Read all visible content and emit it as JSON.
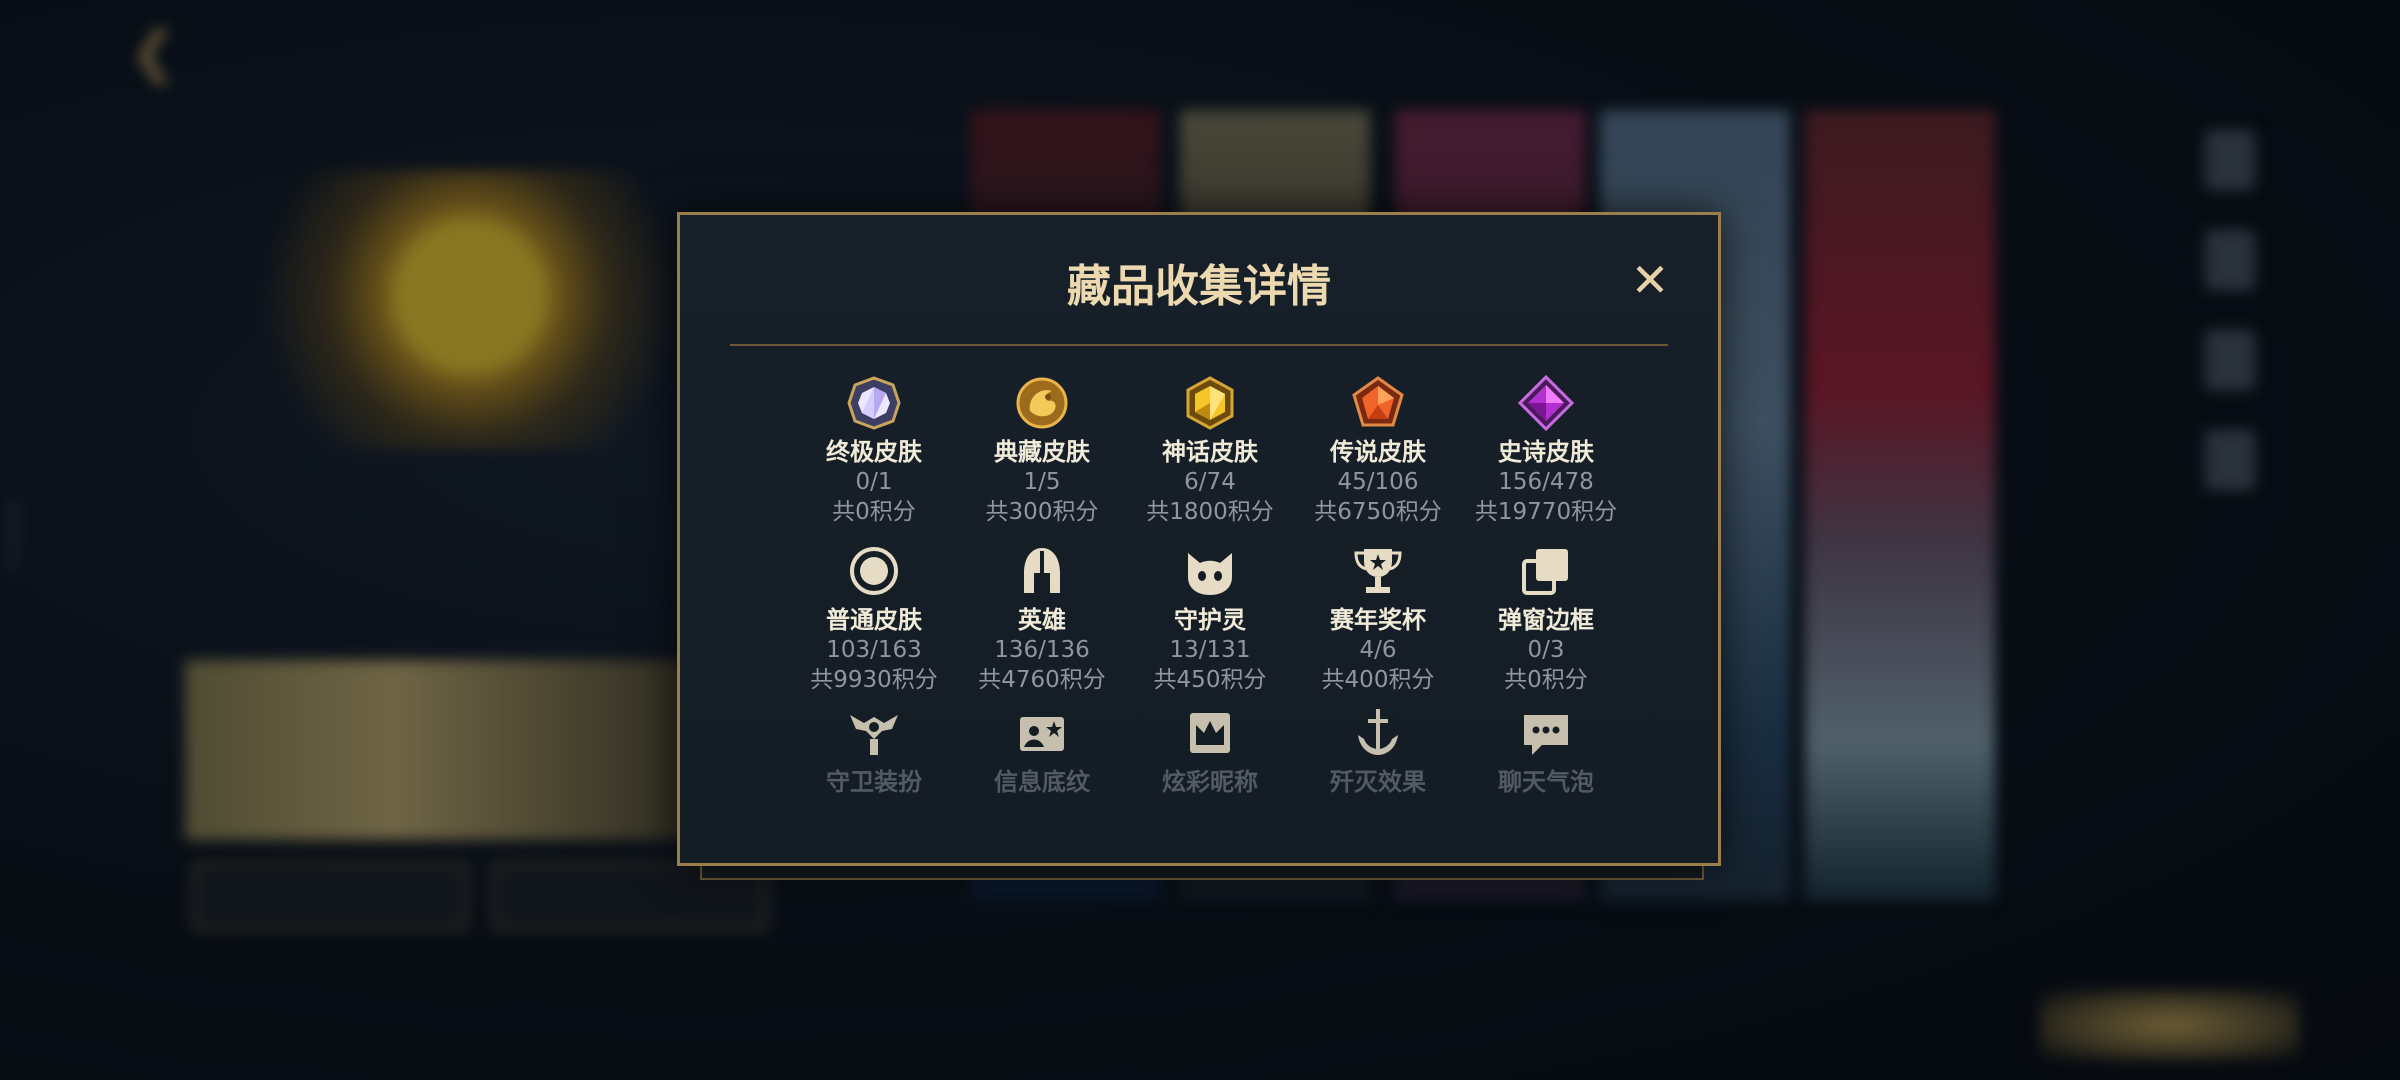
{
  "background": {
    "vertical_id": "5436112",
    "nav_items": [
      "",
      "",
      "",
      "",
      ""
    ]
  },
  "dialog": {
    "title": "藏品收集详情",
    "close_label": "✕",
    "rows": [
      [
        {
          "name": "终极皮肤",
          "count": "0/1",
          "points": "共0积分",
          "icon": "ultimate-gem-icon"
        },
        {
          "name": "典藏皮肤",
          "count": "1/5",
          "points": "共300积分",
          "icon": "dragon-emblem-icon"
        },
        {
          "name": "神话皮肤",
          "count": "6/74",
          "points": "共1800积分",
          "icon": "gold-hexagon-gem-icon"
        },
        {
          "name": "传说皮肤",
          "count": "45/106",
          "points": "共6750积分",
          "icon": "orange-pentagon-gem-icon"
        },
        {
          "name": "史诗皮肤",
          "count": "156/478",
          "points": "共19770积分",
          "icon": "purple-diamond-gem-icon"
        }
      ],
      [
        {
          "name": "普通皮肤",
          "count": "103/163",
          "points": "共9930积分",
          "icon": "circle-ring-icon"
        },
        {
          "name": "英雄",
          "count": "136/136",
          "points": "共4760积分",
          "icon": "helmet-icon"
        },
        {
          "name": "守护灵",
          "count": "13/131",
          "points": "共450积分",
          "icon": "little-legend-icon"
        },
        {
          "name": "赛年奖杯",
          "count": "4/6",
          "points": "共400积分",
          "icon": "trophy-icon"
        },
        {
          "name": "弹窗边框",
          "count": "0/3",
          "points": "共0积分",
          "icon": "frame-stack-icon"
        }
      ],
      [
        {
          "name": "守卫装扮",
          "icon": "ward-icon"
        },
        {
          "name": "信息底纹",
          "icon": "banner-card-icon"
        },
        {
          "name": "炫彩昵称",
          "icon": "crown-nameplate-icon"
        },
        {
          "name": "歼灭效果",
          "icon": "anchor-sword-icon"
        },
        {
          "name": "聊天气泡",
          "icon": "chat-bubble-icon"
        }
      ]
    ]
  },
  "colors": {
    "accent_gold": "#9a7e4c",
    "title": "#ecd9b0",
    "label": "#f0ead8",
    "muted": "#8f969e"
  }
}
